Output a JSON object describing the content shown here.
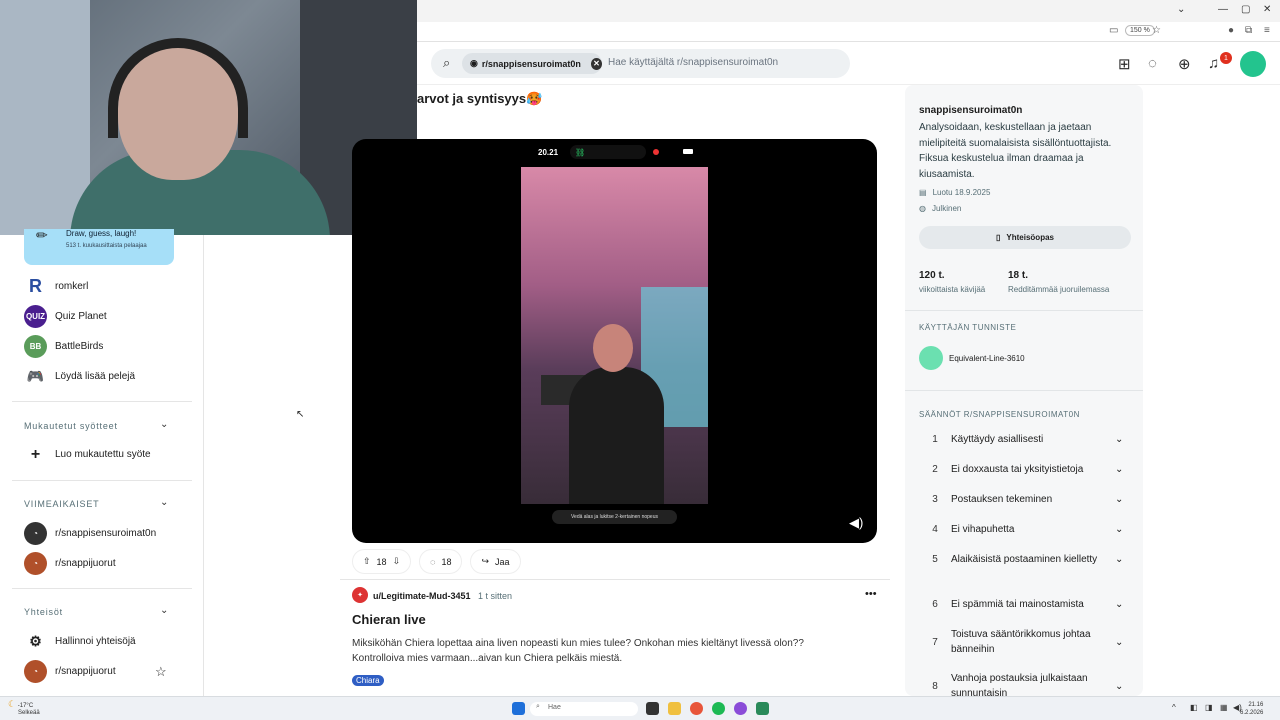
{
  "browser": {
    "zoom": "150 %",
    "window_controls": [
      "⌄",
      "—",
      "▢",
      "✕"
    ]
  },
  "header": {
    "search_chip": "r/snappisensuroimat0n",
    "search_placeholder": "Hae käyttäjältä r/snappisensuroimat0n",
    "notification_count": "1"
  },
  "sidebar": {
    "game_card": {
      "title": "Draw, guess, laugh!",
      "subtitle": "513 t. kuukausittaista pelaajaa"
    },
    "games": [
      {
        "label": "romkerl",
        "icon": "R"
      },
      {
        "label": "Quiz Planet",
        "icon": "QUIZ"
      },
      {
        "label": "BattleBirds",
        "icon": "BB"
      },
      {
        "label": "Löydä lisää pelejä",
        "icon": "gamepad"
      }
    ],
    "custom_feeds_heading": "Mukautetut syötteet",
    "create_feed": "Luo mukautettu syöte",
    "recent_heading": "VIIMEAIKAISET",
    "recent": [
      "r/snappisensuroimat0n",
      "r/snappijuorut"
    ],
    "communities_heading": "Yhteisöt",
    "manage_communities": "Hallinnoi yhteisöjä",
    "communities": [
      "r/snappijuorut"
    ]
  },
  "post": {
    "title_fragment": "arvot ja syntisyys🥵",
    "phone_time": "20.21",
    "video_caption": "Vedä alas ja lukitse 2-kertainen nopeus",
    "upvotes": "18",
    "comments": "18",
    "share_label": "Jaa"
  },
  "post2": {
    "user": "u/Legitimate-Mud-3451",
    "time": "1 t sitten",
    "title": "Chieran live",
    "body": "Miksiköhän Chiera lopettaa aina liven nopeasti kun mies tulee? Onkohan mies kieltänyt livessä olon?? Kontrolloiva mies varmaan...aivan kun Chiera pelkäis miestä.",
    "flair": "Chiara"
  },
  "community": {
    "name": "snappisensuroimat0n",
    "description": "Analysoidaan, keskustellaan ja jaetaan mielipiteitä suomalaisista sisällöntuottajista. Fiksua keskustelua ilman draamaa ja kiusaamista.",
    "created": "Luotu 18.9.2025",
    "visibility": "Julkinen",
    "guide_button": "Yhteisöopas",
    "stats": [
      {
        "value": "120 t.",
        "label": "viikoittaista kävijää"
      },
      {
        "value": "18 t.",
        "label": "Redditämmää juoruilemassa"
      }
    ],
    "flair_heading": "KÄYTTÄJÄN TUNNISTE",
    "flair_user": "Equivalent-Line-3610",
    "rules_heading": "SÄÄNNÖT R/SNAPPISENSUROIMAT0N",
    "rules": [
      {
        "n": "1",
        "text": "Käyttäydy asiallisesti"
      },
      {
        "n": "2",
        "text": "Ei doxxausta tai yksityistietoja"
      },
      {
        "n": "3",
        "text": "Postauksen tekeminen"
      },
      {
        "n": "4",
        "text": "Ei vihapuhetta"
      },
      {
        "n": "5",
        "text": "Alaikäisistä postaaminen kielletty"
      },
      {
        "n": "6",
        "text": "Ei spämmiä tai mainostamista"
      },
      {
        "n": "7",
        "text": "Toistuva sääntörikkomus johtaa bänneihin"
      },
      {
        "n": "8",
        "text": "Vanhoja postauksia julkaistaan sunnuntaisin"
      }
    ]
  },
  "taskbar": {
    "temp": "-17°C",
    "weather": "Selkeää",
    "search": "Hae",
    "time": "21.16",
    "date": "6.2.2026"
  }
}
